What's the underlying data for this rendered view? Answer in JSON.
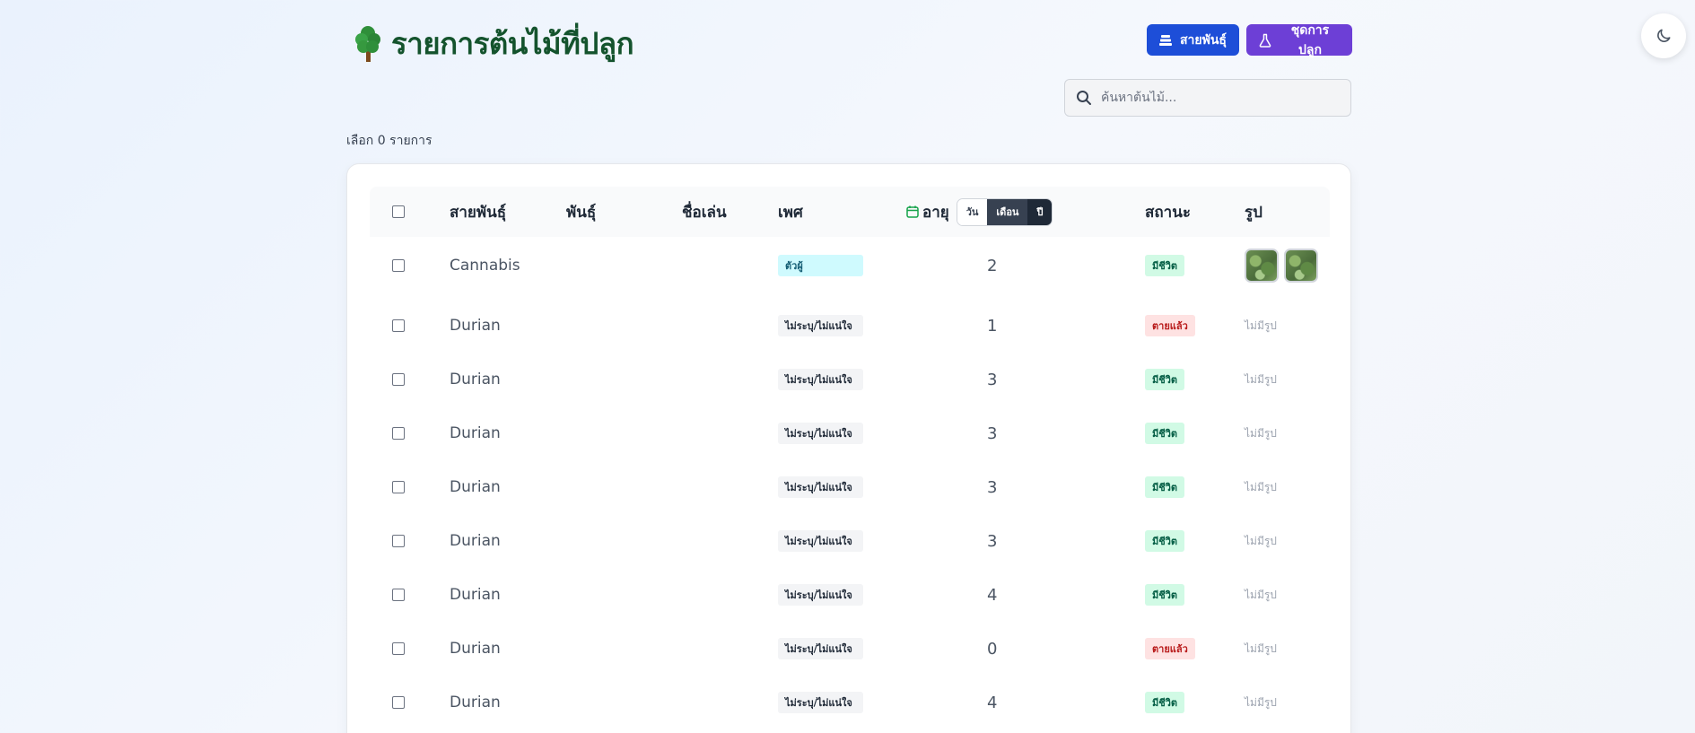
{
  "header": {
    "title": "รายการต้นไม้ที่ปลูก",
    "strain_button": "สายพันธุ์",
    "kit_button": "ชุดการปลูก"
  },
  "search": {
    "placeholder": "ค้นหาต้นไม้..."
  },
  "selection": {
    "count_label": "เลือก 0 รายการ"
  },
  "table": {
    "columns": {
      "strain": "สายพันธุ์",
      "variety": "พันธุ์",
      "nickname": "ชื่อเล่น",
      "sex": "เพศ",
      "age": "อายุ",
      "status": "สถานะ",
      "photo": "รูป"
    },
    "age_toggle": {
      "day": "วัน",
      "month": "เดือน",
      "year": "ปี"
    },
    "rows": [
      {
        "strain": "Cannabis",
        "sex": "ตัวผู้",
        "age": "2",
        "status": "มีชีวิต",
        "photo": ""
      },
      {
        "strain": "Durian",
        "sex": "ไม่ระบุ/ไม่แน่ใจ",
        "age": "1",
        "status": "ตายแล้ว",
        "photo": "ไม่มีรูป"
      },
      {
        "strain": "Durian",
        "sex": "ไม่ระบุ/ไม่แน่ใจ",
        "age": "3",
        "status": "มีชีวิต",
        "photo": "ไม่มีรูป"
      },
      {
        "strain": "Durian",
        "sex": "ไม่ระบุ/ไม่แน่ใจ",
        "age": "3",
        "status": "มีชีวิต",
        "photo": "ไม่มีรูป"
      },
      {
        "strain": "Durian",
        "sex": "ไม่ระบุ/ไม่แน่ใจ",
        "age": "3",
        "status": "มีชีวิต",
        "photo": "ไม่มีรูป"
      },
      {
        "strain": "Durian",
        "sex": "ไม่ระบุ/ไม่แน่ใจ",
        "age": "3",
        "status": "มีชีวิต",
        "photo": "ไม่มีรูป"
      },
      {
        "strain": "Durian",
        "sex": "ไม่ระบุ/ไม่แน่ใจ",
        "age": "4",
        "status": "มีชีวิต",
        "photo": "ไม่มีรูป"
      },
      {
        "strain": "Durian",
        "sex": "ไม่ระบุ/ไม่แน่ใจ",
        "age": "0",
        "status": "ตายแล้ว",
        "photo": "ไม่มีรูป"
      },
      {
        "strain": "Durian",
        "sex": "ไม่ระบุ/ไม่แน่ใจ",
        "age": "4",
        "status": "มีชีวิต",
        "photo": "ไม่มีรูป"
      }
    ]
  }
}
